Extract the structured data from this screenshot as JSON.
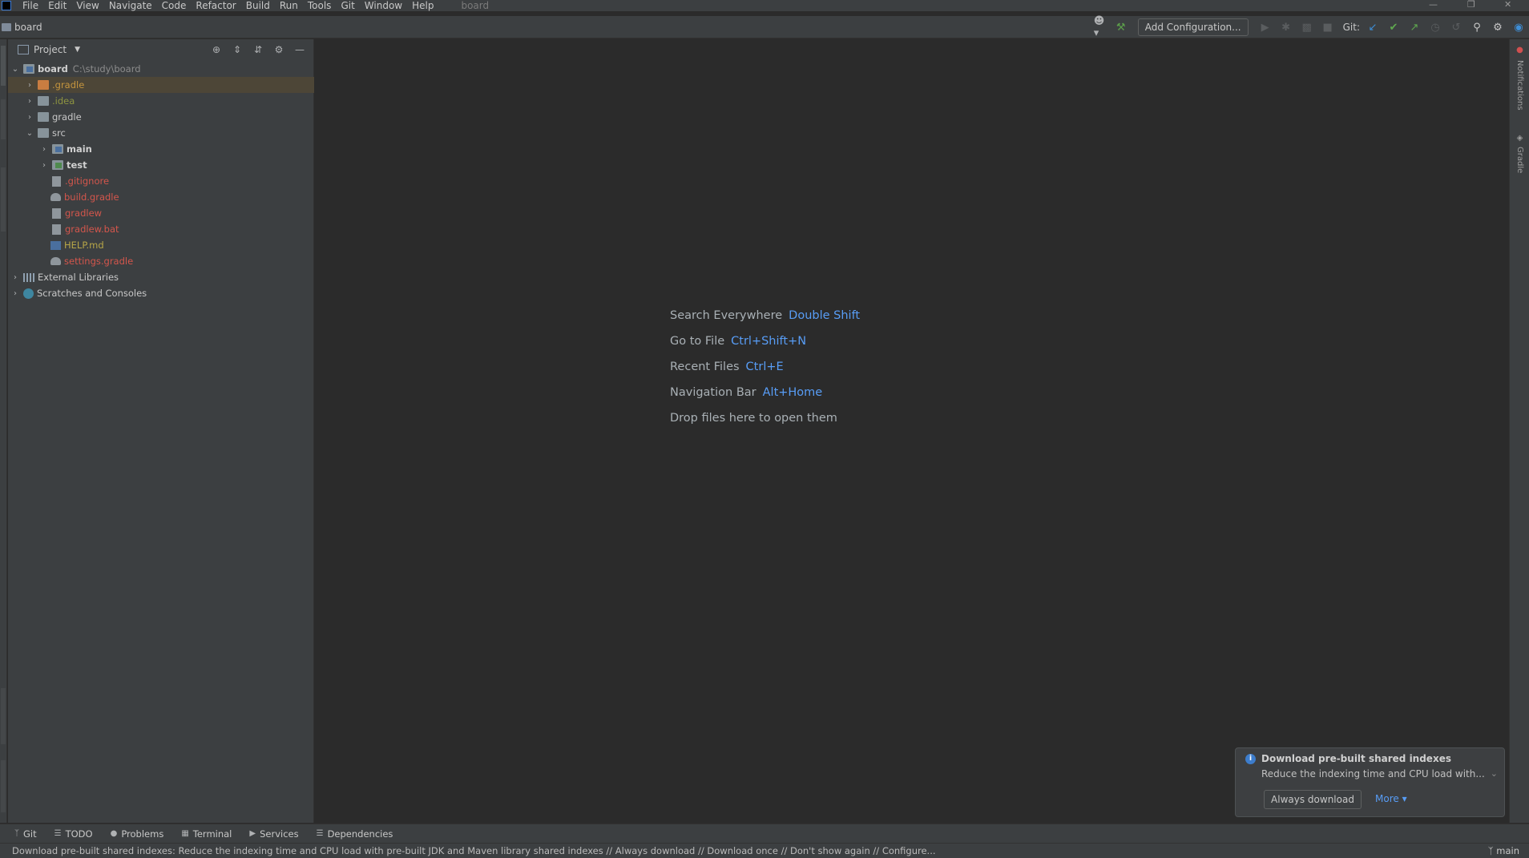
{
  "menubar": {
    "items": [
      "File",
      "Edit",
      "View",
      "Navigate",
      "Code",
      "Refactor",
      "Build",
      "Run",
      "Tools",
      "Git",
      "Window",
      "Help"
    ],
    "project_title": "board"
  },
  "navbar": {
    "breadcrumb": "board",
    "add_configuration": "Add Configuration...",
    "git_label": "Git:"
  },
  "project_panel": {
    "title": "Project",
    "tree": [
      {
        "label": "board",
        "detail": "C:\\study\\board"
      },
      {
        "label": ".gradle"
      },
      {
        "label": ".idea"
      },
      {
        "label": "gradle"
      },
      {
        "label": "src"
      },
      {
        "label": "main"
      },
      {
        "label": "test"
      },
      {
        "label": ".gitignore"
      },
      {
        "label": "build.gradle"
      },
      {
        "label": "gradlew"
      },
      {
        "label": "gradlew.bat"
      },
      {
        "label": "HELP.md"
      },
      {
        "label": "settings.gradle"
      },
      {
        "label": "External Libraries"
      },
      {
        "label": "Scratches and Consoles"
      }
    ]
  },
  "editor": {
    "hints": [
      {
        "label": "Search Everywhere",
        "key": "Double Shift"
      },
      {
        "label": "Go to File",
        "key": "Ctrl+Shift+N"
      },
      {
        "label": "Recent Files",
        "key": "Ctrl+E"
      },
      {
        "label": "Navigation Bar",
        "key": "Alt+Home"
      },
      {
        "label": "Drop files here to open them",
        "key": ""
      }
    ]
  },
  "right_stripe": {
    "notifications": "Notifications",
    "gradle": "Gradle"
  },
  "notification": {
    "title": "Download pre-built shared indexes",
    "body": "Reduce the indexing time and CPU load with...",
    "button": "Always download",
    "more": "More ▾"
  },
  "bottom_bar": {
    "tabs": [
      "Git",
      "TODO",
      "Problems",
      "Terminal",
      "Services",
      "Dependencies"
    ]
  },
  "statusbar": {
    "message": "Download pre-built shared indexes: Reduce the indexing time and CPU load with pre-built JDK and Maven library shared indexes // Always download // Download once // Don't show again // Configure...",
    "branch": "main"
  },
  "colors": {
    "accent_blue": "#589df6",
    "selection": "#4d4637",
    "panel_bg": "#3c3f41",
    "editor_bg": "#2b2b2b"
  }
}
